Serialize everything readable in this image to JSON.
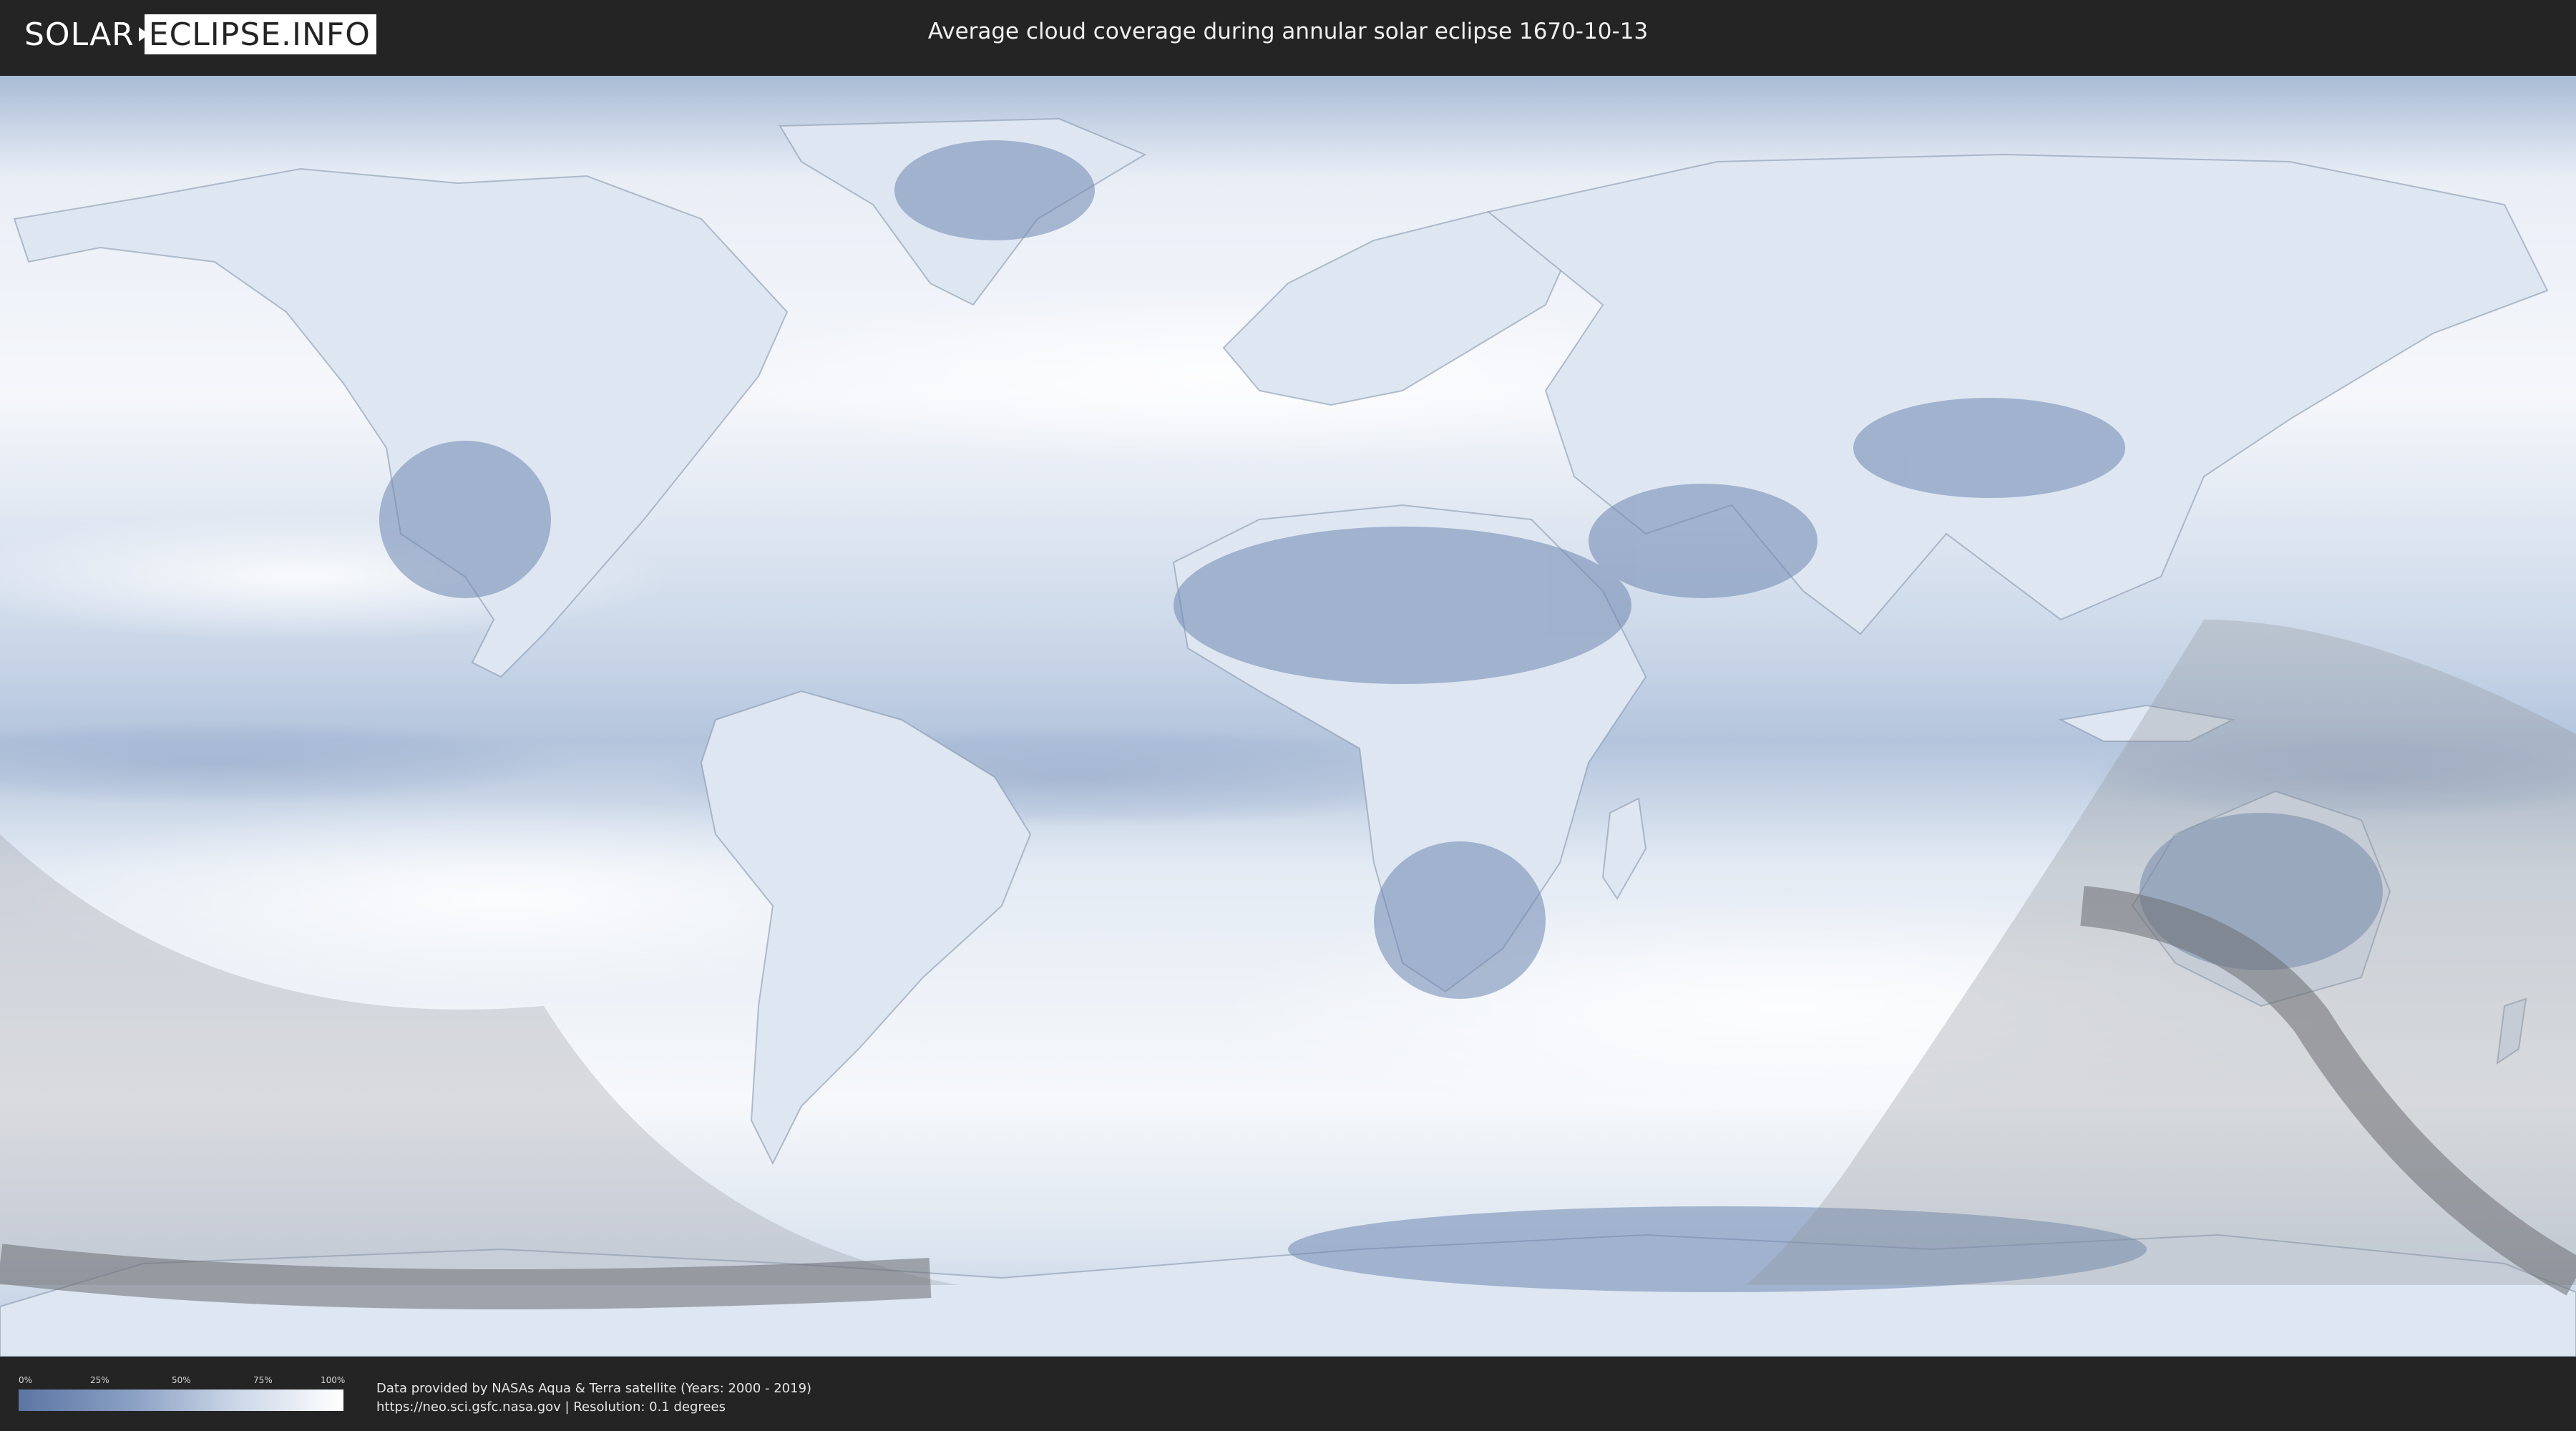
{
  "header": {
    "logo_left": "SOLAR",
    "logo_right": "ECLIPSE.INFO",
    "title": "Average cloud coverage during annular solar eclipse 1670-10-13"
  },
  "legend": {
    "ticks": [
      "0%",
      "25%",
      "50%",
      "75%",
      "100%"
    ],
    "values": [
      0,
      25,
      50,
      75,
      100
    ],
    "color_low": "#5c76a4",
    "color_high": "#ffffff"
  },
  "credits": {
    "line1": "Data provided by NASAs Aqua & Terra satellite (Years: 2000 - 2019)",
    "line2": "https://neo.sci.gsfc.nasa.gov | Resolution: 0.1 degrees"
  },
  "colors": {
    "header_bg": "#242424",
    "cloud_light": "#f4f7fb",
    "cloud_dark": "#6a82ad",
    "shadow_overlay": "#8f9196",
    "path_band": "#6b6d72"
  }
}
